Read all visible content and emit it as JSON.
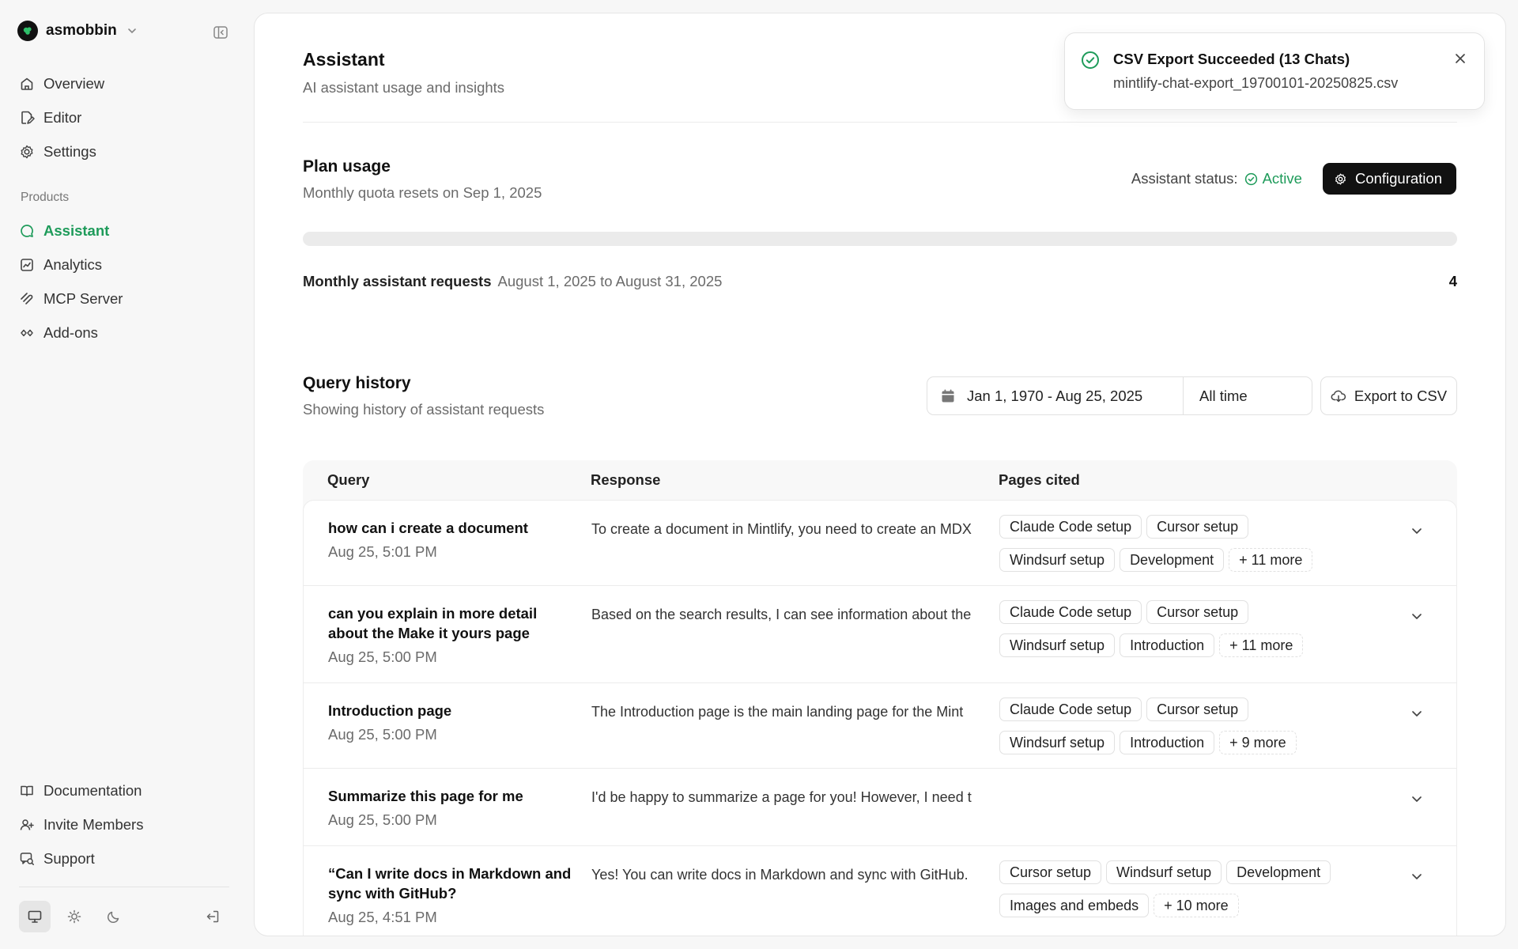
{
  "sidebar": {
    "org_name": "asmobbin",
    "nav": [
      {
        "label": "Overview",
        "icon": "home-icon"
      },
      {
        "label": "Editor",
        "icon": "editor-icon"
      },
      {
        "label": "Settings",
        "icon": "gear-icon"
      }
    ],
    "section_label": "Products",
    "products": [
      {
        "label": "Assistant",
        "icon": "chat-icon",
        "active": true
      },
      {
        "label": "Analytics",
        "icon": "chart-icon"
      },
      {
        "label": "MCP Server",
        "icon": "mcp-icon"
      },
      {
        "label": "Add-ons",
        "icon": "addons-icon"
      }
    ],
    "footer": [
      {
        "label": "Documentation",
        "icon": "book-icon"
      },
      {
        "label": "Invite Members",
        "icon": "users-icon"
      },
      {
        "label": "Support",
        "icon": "support-icon"
      }
    ]
  },
  "header": {
    "title": "Assistant",
    "subtitle": "AI assistant usage and insights"
  },
  "plan": {
    "title": "Plan usage",
    "subtitle": "Monthly quota resets on Sep 1, 2025",
    "status_label": "Assistant status:",
    "status_value": "Active",
    "config_label": "Configuration",
    "progress_percent": 0,
    "requests_label": "Monthly assistant requests",
    "requests_range": "August 1, 2025 to August 31, 2025",
    "requests_count": "4"
  },
  "history": {
    "title": "Query history",
    "subtitle": "Showing history of assistant requests",
    "date_range": "Jan 1, 1970 - Aug 25, 2025",
    "period": "All time",
    "export_label": "Export to CSV",
    "columns": [
      "Query",
      "Response",
      "Pages cited"
    ],
    "rows": [
      {
        "query": "how can i create a document",
        "date": "Aug 25, 5:01 PM",
        "response": "To create a document in Mintlify, you need to create an MDX",
        "pages": [
          "Claude Code setup",
          "Cursor setup",
          "Windsurf setup",
          "Development"
        ],
        "more": "+ 11 more"
      },
      {
        "query": "can you explain in more detail about the Make it yours page",
        "date": "Aug 25, 5:00 PM",
        "response": "Based on the search results, I can see information about the",
        "pages": [
          "Claude Code setup",
          "Cursor setup",
          "Windsurf setup",
          "Introduction"
        ],
        "more": "+ 11 more"
      },
      {
        "query": "Introduction page",
        "date": "Aug 25, 5:00 PM",
        "response": "The Introduction page is the main landing page for the Mint",
        "pages": [
          "Claude Code setup",
          "Cursor setup",
          "Windsurf setup",
          "Introduction"
        ],
        "more": "+ 9 more"
      },
      {
        "query": "Summarize this page for me",
        "date": "Aug 25, 5:00 PM",
        "response": "I'd be happy to summarize a page for you! However, I need t",
        "pages": [],
        "more": ""
      },
      {
        "query": "“Can I write docs in Markdown and sync with GitHub?",
        "date": "Aug 25, 4:51 PM",
        "response": "Yes! You can write docs in Markdown and sync with GitHub.",
        "pages": [
          "Cursor setup",
          "Windsurf setup",
          "Development",
          "Images and embeds"
        ],
        "more": "+ 10 more"
      }
    ]
  },
  "toast": {
    "title": "CSV Export Succeeded (13 Chats)",
    "filename": "mintlify-chat-export_19700101-20250825.csv"
  },
  "colors": {
    "accent": "#1e9b5a",
    "button_dark": "#111111"
  }
}
